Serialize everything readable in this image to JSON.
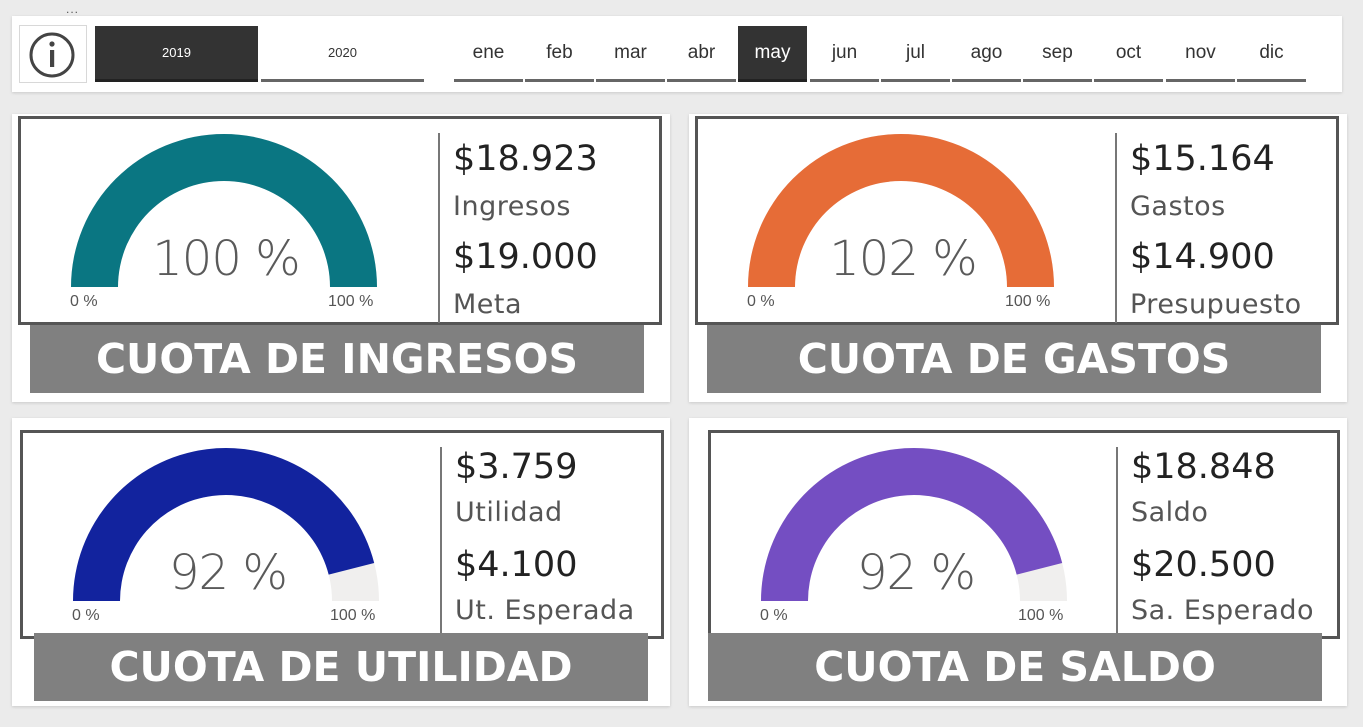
{
  "more_options": "...",
  "years": [
    {
      "label": "2019",
      "active": true
    },
    {
      "label": "2020",
      "active": false
    }
  ],
  "months": [
    {
      "label": "ene",
      "active": false
    },
    {
      "label": "feb",
      "active": false
    },
    {
      "label": "mar",
      "active": false
    },
    {
      "label": "abr",
      "active": false
    },
    {
      "label": "may",
      "active": true
    },
    {
      "label": "jun",
      "active": false
    },
    {
      "label": "jul",
      "active": false
    },
    {
      "label": "ago",
      "active": false
    },
    {
      "label": "sep",
      "active": false
    },
    {
      "label": "oct",
      "active": false
    },
    {
      "label": "nov",
      "active": false
    },
    {
      "label": "dic",
      "active": false
    }
  ],
  "cards": [
    {
      "id": "ingresos",
      "title": "CUOTA DE INGRESOS",
      "gauge": {
        "value_label": "100 %",
        "fill_fraction": 1.0,
        "min_label": "0 %",
        "max_label": "100 %",
        "color": "#0a7682"
      },
      "value1": "$18.923",
      "label1": "Ingresos",
      "value2": "$19.000",
      "label2": "Meta"
    },
    {
      "id": "gastos",
      "title": "CUOTA DE GASTOS",
      "gauge": {
        "value_label": "102 %",
        "fill_fraction": 1.0,
        "min_label": "0 %",
        "max_label": "100 %",
        "color": "#e66c37"
      },
      "value1": "$15.164",
      "label1": "Gastos",
      "value2": "$14.900",
      "label2": "Presupuesto"
    },
    {
      "id": "utilidad",
      "title": "CUOTA DE UTILIDAD",
      "gauge": {
        "value_label": "92 %",
        "fill_fraction": 0.92,
        "min_label": "0 %",
        "max_label": "100 %",
        "color": "#12239e"
      },
      "value1": "$3.759",
      "label1": "Utilidad",
      "value2": "$4.100",
      "label2": "Ut. Esperada"
    },
    {
      "id": "saldo",
      "title": "CUOTA DE SALDO",
      "gauge": {
        "value_label": "92 %",
        "fill_fraction": 0.92,
        "min_label": "0 %",
        "max_label": "100 %",
        "color": "#744ec2"
      },
      "value1": "$18.848",
      "label1": "Saldo",
      "value2": "$20.500",
      "label2": "Sa. Esperado"
    }
  ],
  "colors": {
    "track": "#f0efee",
    "active_slicer": "#333333",
    "title_band": "#808080"
  }
}
